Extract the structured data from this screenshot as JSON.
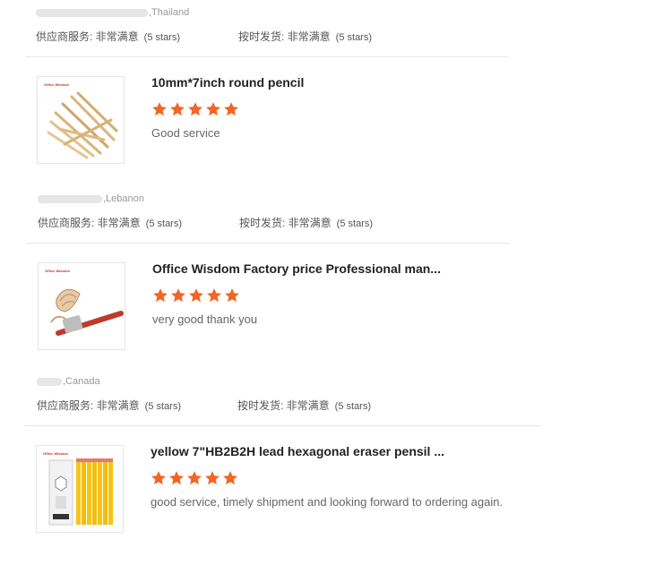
{
  "reviews": [
    {
      "country": ",Thailand",
      "supplier_label": "供应商服务: 非常满意",
      "supplier_stars": "(5 stars)",
      "shipping_label": "按时发货: 非常满意",
      "shipping_stars": "(5 stars)"
    },
    {
      "product_title": "10mm*7inch round pencil",
      "image_brand": "Office Wisdom",
      "rating": 5,
      "comment": "Good service",
      "country": ",Lebanon",
      "supplier_label": "供应商服务: 非常满意",
      "supplier_stars": "(5 stars)",
      "shipping_label": "按时发货: 非常满意",
      "shipping_stars": "(5 stars)"
    },
    {
      "product_title": "Office Wisdom Factory price Professional man...",
      "image_brand": "Office Wisdom",
      "rating": 5,
      "comment": "very good thank you",
      "country": ",Canada",
      "supplier_label": "供应商服务: 非常满意",
      "supplier_stars": "(5 stars)",
      "shipping_label": "按时发货: 非常满意",
      "shipping_stars": "(5 stars)"
    },
    {
      "product_title": "yellow 7\"HB2B2H lead hexagonal eraser pensil ...",
      "image_brand": "Office Wisdom",
      "rating": 5,
      "comment": "good service, timely shipment and looking forward to ordering again."
    }
  ],
  "colors": {
    "star": "#f26522",
    "divider": "#e8e8e8"
  },
  "icons": {
    "star": "star-icon"
  }
}
